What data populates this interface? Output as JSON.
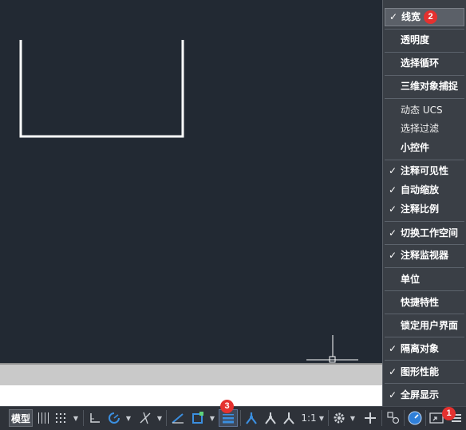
{
  "statusbar": {
    "model_label": "模型",
    "scale_label": "1:1"
  },
  "menu": {
    "items": [
      {
        "label": "线宽",
        "checked": true,
        "active": true
      },
      {
        "label": "透明度",
        "checked": false
      },
      {
        "label": "选择循环",
        "checked": false
      },
      {
        "label": "三维对象捕捉",
        "checked": false
      },
      {
        "label": "动态 UCS",
        "checked": false
      },
      {
        "label": "选择过滤",
        "checked": false
      },
      {
        "label": "小控件",
        "checked": false
      },
      {
        "label": "注释可见性",
        "checked": true
      },
      {
        "label": "自动缩放",
        "checked": true
      },
      {
        "label": "注释比例",
        "checked": true
      },
      {
        "label": "切换工作空间",
        "checked": true
      },
      {
        "label": "注释监视器",
        "checked": true
      },
      {
        "label": "单位",
        "checked": false
      },
      {
        "label": "快捷特性",
        "checked": false
      },
      {
        "label": "锁定用户界面",
        "checked": false
      },
      {
        "label": "隔离对象",
        "checked": true
      },
      {
        "label": "图形性能",
        "checked": true
      },
      {
        "label": "全屏显示",
        "checked": true
      }
    ],
    "check_glyph": "✓"
  },
  "badges": {
    "one": "1",
    "two": "2",
    "three": "3"
  },
  "colors": {
    "canvas": "#222933",
    "menu_bg": "#3a3f46",
    "badge": "#e5312f",
    "statusbar_bg": "#2e3239",
    "accent_blue": "#3b8fe0"
  }
}
